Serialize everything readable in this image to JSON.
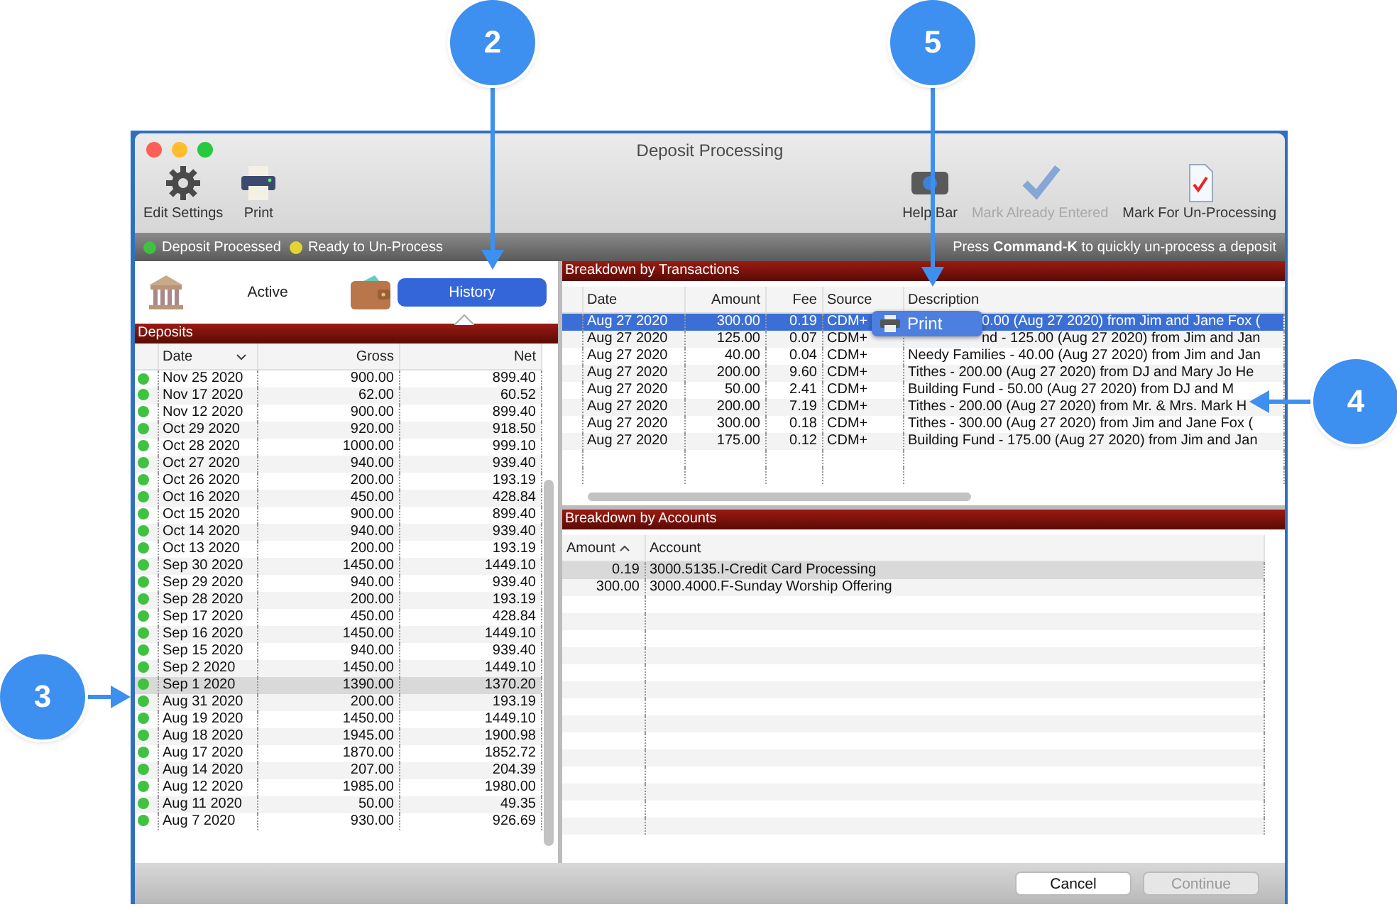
{
  "window": {
    "title": "Deposit Processing"
  },
  "toolbar_left": [
    {
      "label": "Edit Settings",
      "disabled": false
    },
    {
      "label": "Print",
      "disabled": false
    }
  ],
  "toolbar_right": [
    {
      "label": "Help Bar",
      "disabled": false
    },
    {
      "label": "Mark Already Entered",
      "disabled": true
    },
    {
      "label": "Mark For Un-Processing",
      "disabled": false
    }
  ],
  "legend": [
    {
      "label": "Deposit Processed",
      "color": "#3fc23f"
    },
    {
      "label": "Ready to Un-Process",
      "color": "#e2d532"
    }
  ],
  "hint": "Press **Command-K** to quickly un-process a deposit",
  "tabs": [
    {
      "label": "Active",
      "selected": false
    },
    {
      "label": "History",
      "selected": true
    }
  ],
  "deposits": {
    "title": "Deposits",
    "columns": [
      "Date",
      "Gross",
      "Net"
    ],
    "rows": [
      {
        "date": "Nov 25 2020",
        "gross": "900.00",
        "net": "899.40",
        "color": "#3fc23f",
        "selected": false
      },
      {
        "date": "Nov 17 2020",
        "gross": "62.00",
        "net": "60.52",
        "color": "#3fc23f",
        "selected": false
      },
      {
        "date": "Nov 12 2020",
        "gross": "900.00",
        "net": "899.40",
        "color": "#3fc23f",
        "selected": false
      },
      {
        "date": "Oct 29 2020",
        "gross": "920.00",
        "net": "918.50",
        "color": "#3fc23f",
        "selected": false
      },
      {
        "date": "Oct 28 2020",
        "gross": "1000.00",
        "net": "999.10",
        "color": "#3fc23f",
        "selected": false
      },
      {
        "date": "Oct 27 2020",
        "gross": "940.00",
        "net": "939.40",
        "color": "#3fc23f",
        "selected": false
      },
      {
        "date": "Oct 26 2020",
        "gross": "200.00",
        "net": "193.19",
        "color": "#3fc23f",
        "selected": false
      },
      {
        "date": "Oct 16 2020",
        "gross": "450.00",
        "net": "428.84",
        "color": "#3fc23f",
        "selected": false
      },
      {
        "date": "Oct 15 2020",
        "gross": "900.00",
        "net": "899.40",
        "color": "#3fc23f",
        "selected": false
      },
      {
        "date": "Oct 14 2020",
        "gross": "940.00",
        "net": "939.40",
        "color": "#3fc23f",
        "selected": false
      },
      {
        "date": "Oct 13 2020",
        "gross": "200.00",
        "net": "193.19",
        "color": "#3fc23f",
        "selected": false
      },
      {
        "date": "Sep 30 2020",
        "gross": "1450.00",
        "net": "1449.10",
        "color": "#3fc23f",
        "selected": false
      },
      {
        "date": "Sep 29 2020",
        "gross": "940.00",
        "net": "939.40",
        "color": "#3fc23f",
        "selected": false
      },
      {
        "date": "Sep 28 2020",
        "gross": "200.00",
        "net": "193.19",
        "color": "#3fc23f",
        "selected": false
      },
      {
        "date": "Sep 17 2020",
        "gross": "450.00",
        "net": "428.84",
        "color": "#3fc23f",
        "selected": false
      },
      {
        "date": "Sep 16 2020",
        "gross": "1450.00",
        "net": "1449.10",
        "color": "#3fc23f",
        "selected": false
      },
      {
        "date": "Sep 15 2020",
        "gross": "940.00",
        "net": "939.40",
        "color": "#3fc23f",
        "selected": false
      },
      {
        "date": "Sep 2 2020",
        "gross": "1450.00",
        "net": "1449.10",
        "color": "#3fc23f",
        "selected": false
      },
      {
        "date": "Sep 1 2020",
        "gross": "1390.00",
        "net": "1370.20",
        "color": "#3fc23f",
        "selected": true
      },
      {
        "date": "Aug 31 2020",
        "gross": "200.00",
        "net": "193.19",
        "color": "#3fc23f",
        "selected": false
      },
      {
        "date": "Aug 19 2020",
        "gross": "1450.00",
        "net": "1449.10",
        "color": "#3fc23f",
        "selected": false
      },
      {
        "date": "Aug 18 2020",
        "gross": "1945.00",
        "net": "1900.98",
        "color": "#3fc23f",
        "selected": false
      },
      {
        "date": "Aug 17 2020",
        "gross": "1870.00",
        "net": "1852.72",
        "color": "#3fc23f",
        "selected": false
      },
      {
        "date": "Aug 14 2020",
        "gross": "207.00",
        "net": "204.39",
        "color": "#3fc23f",
        "selected": false
      },
      {
        "date": "Aug 12 2020",
        "gross": "1985.00",
        "net": "1980.00",
        "color": "#3fc23f",
        "selected": false
      },
      {
        "date": "Aug 11 2020",
        "gross": "50.00",
        "net": "49.35",
        "color": "#3fc23f",
        "selected": false
      },
      {
        "date": "Aug 7 2020",
        "gross": "930.00",
        "net": "926.69",
        "color": "#3fc23f",
        "selected": false
      }
    ]
  },
  "transactions": {
    "title": "Breakdown by Transactions",
    "columns": [
      "Date",
      "Amount",
      "Fee",
      "Source",
      "Description"
    ],
    "rows": [
      {
        "date": "Aug 27 2020",
        "amount": "300.00",
        "fee": "0.19",
        "source": "CDM+",
        "description": "0.00 (Aug 27 2020) from Jim and Jane Fox (",
        "selected": true
      },
      {
        "date": "Aug 27 2020",
        "amount": "125.00",
        "fee": "0.07",
        "source": "CDM+",
        "description": "nd - 125.00 (Aug 27 2020) from Jim and Jan",
        "selected": false
      },
      {
        "date": "Aug 27 2020",
        "amount": "40.00",
        "fee": "0.04",
        "source": "CDM+",
        "description": "Needy Families - 40.00 (Aug 27 2020) from Jim and Jan",
        "selected": false
      },
      {
        "date": "Aug 27 2020",
        "amount": "200.00",
        "fee": "9.60",
        "source": "CDM+",
        "description": "Tithes - 200.00 (Aug 27 2020) from DJ and Mary Jo He",
        "selected": false
      },
      {
        "date": "Aug 27 2020",
        "amount": "50.00",
        "fee": "2.41",
        "source": "CDM+",
        "description": "Building Fund - 50.00 (Aug 27 2020) from DJ and M",
        "selected": false
      },
      {
        "date": "Aug 27 2020",
        "amount": "200.00",
        "fee": "7.19",
        "source": "CDM+",
        "description": "Tithes - 200.00 (Aug 27 2020) from Mr. & Mrs. Mark H",
        "selected": false
      },
      {
        "date": "Aug 27 2020",
        "amount": "300.00",
        "fee": "0.18",
        "source": "CDM+",
        "description": "Tithes - 300.00 (Aug 27 2020) from Jim and Jane Fox (",
        "selected": false
      },
      {
        "date": "Aug 27 2020",
        "amount": "175.00",
        "fee": "0.12",
        "source": "CDM+",
        "description": "Building Fund - 175.00 (Aug 27 2020) from Jim and Jan",
        "selected": false
      }
    ],
    "context_menu": {
      "label": "Print"
    }
  },
  "accounts": {
    "title": "Breakdown by Accounts",
    "columns": [
      "Amount",
      "Account"
    ],
    "rows": [
      {
        "amount": "0.19",
        "account": "3000.5135.I-Credit Card Processing",
        "selected": true
      },
      {
        "amount": "300.00",
        "account": "3000.4000.F-Sunday Worship Offering",
        "selected": false
      }
    ]
  },
  "footer_buttons": [
    {
      "label": "Cancel",
      "disabled": false
    },
    {
      "label": "Continue",
      "disabled": true
    }
  ],
  "callouts": [
    {
      "number": "2",
      "kind": "down"
    },
    {
      "number": "5",
      "kind": "down"
    },
    {
      "number": "3",
      "kind": "right"
    },
    {
      "number": "4",
      "kind": "left"
    }
  ]
}
